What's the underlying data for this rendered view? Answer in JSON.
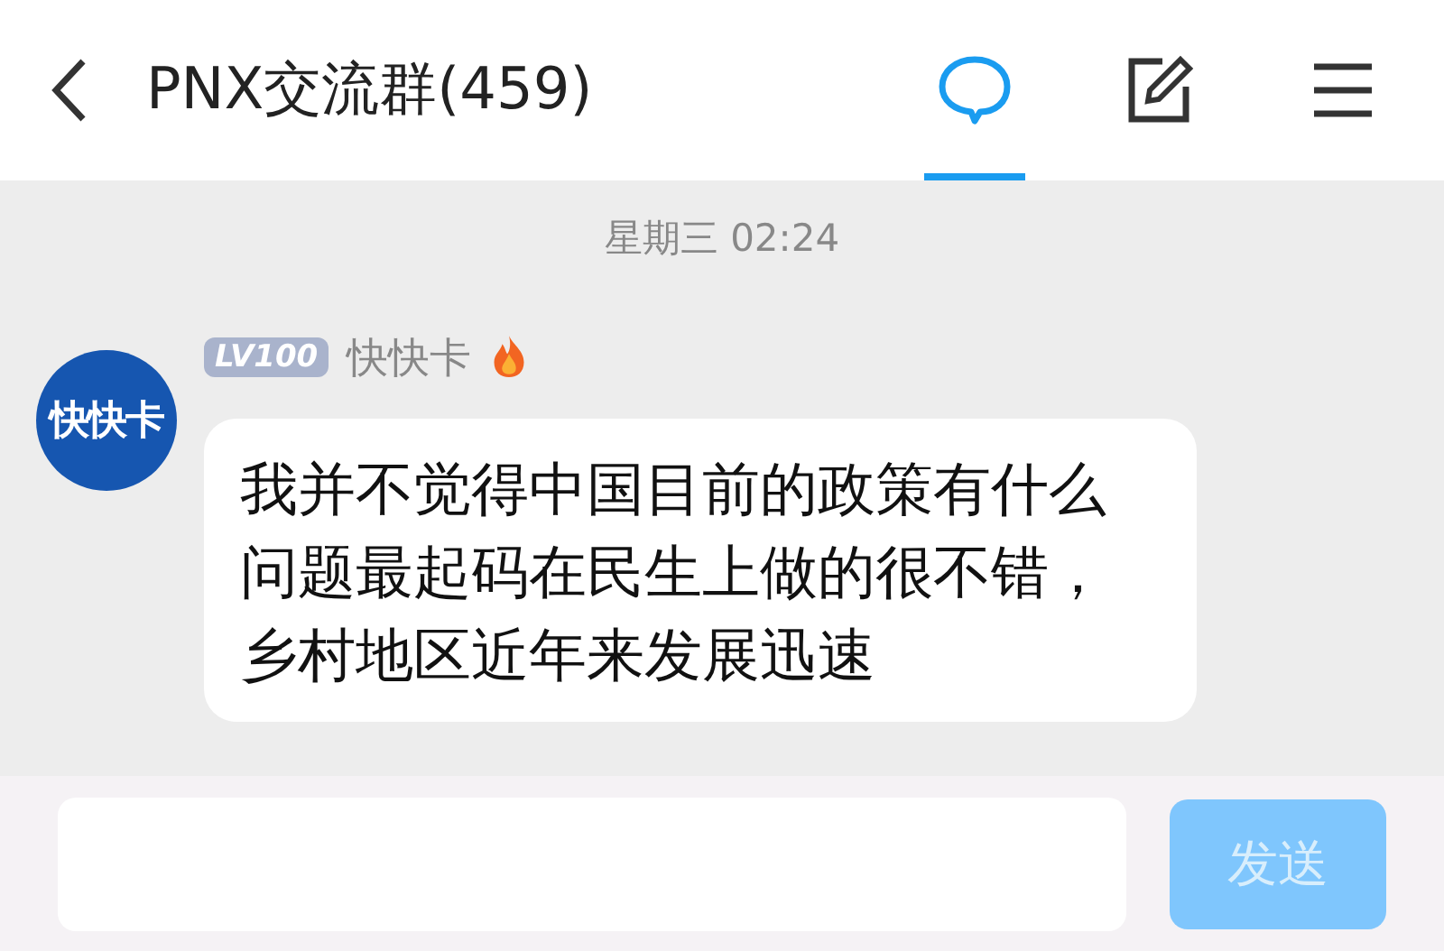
{
  "header": {
    "title": "PNX交流群(459)",
    "actions": [
      {
        "kind": "chat",
        "selected": true
      },
      {
        "kind": "edit",
        "selected": false
      },
      {
        "kind": "menu",
        "selected": false
      }
    ]
  },
  "messages": [
    {
      "kind": "time",
      "text": "星期三 02:24"
    },
    {
      "kind": "message",
      "avatar_text": "快快卡",
      "level_badge": "LV100",
      "sender": "快快卡",
      "text": "我并不觉得中国目前的政策有什么问题最起码在民生上做的很不错，乡村地区近年来发展迅速"
    }
  ],
  "composer": {
    "send_label": "发送",
    "send_disabled": true
  }
}
